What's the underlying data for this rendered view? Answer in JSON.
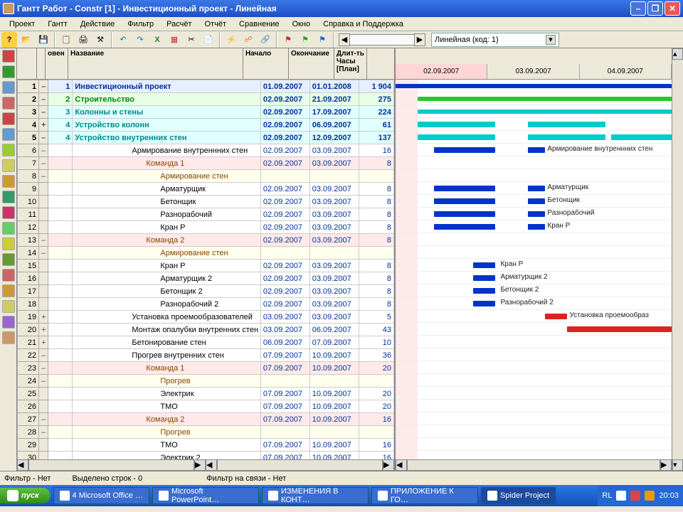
{
  "title": "Гантт Работ - Constr [1] - Инвестиционный проект - Линейная",
  "menu": [
    "Проект",
    "Гантт",
    "Действие",
    "Фильтр",
    "Расчёт",
    "Отчёт",
    "Сравнение",
    "Окно",
    "Справка и Поддержка"
  ],
  "combo": "Линейная (код: 1)",
  "headers": {
    "idx": "",
    "level": "овен",
    "name": "Название",
    "start": "Начало",
    "end": "Окончание",
    "dur": "Длит-ть Часы [План]"
  },
  "timeline": [
    "02.09.2007",
    "03.09.2007",
    "04.09.2007"
  ],
  "rows": [
    {
      "i": 1,
      "exp": "–",
      "lvl": "1",
      "name": "Инвестиционный проект",
      "start": "01.09.2007",
      "end": "01.01.2008",
      "dur": "1 904",
      "cls": "bold bgblue",
      "acc": "navy",
      "bars": [
        {
          "s": 0,
          "w": 100,
          "c": "#0033cc",
          "sum": true
        }
      ]
    },
    {
      "i": 2,
      "exp": "–",
      "lvl": "2",
      "name": "Строительство",
      "start": "02.09.2007",
      "end": "21.09.2007",
      "dur": "275",
      "cls": "bold bggreen",
      "acc": "green",
      "bars": [
        {
          "s": 8,
          "w": 100,
          "c": "#22cc22",
          "sum": true
        }
      ]
    },
    {
      "i": 3,
      "exp": "–",
      "lvl": "3",
      "name": "Колонны и стены",
      "start": "02.09.2007",
      "end": "17.09.2007",
      "dur": "224",
      "cls": "bold bgcyan",
      "acc": "teal",
      "bars": [
        {
          "s": 8,
          "w": 100,
          "c": "#00cccc",
          "sum": true
        }
      ]
    },
    {
      "i": 4,
      "exp": "+",
      "lvl": "4",
      "name": "Устройство колонн",
      "start": "02.09.2007",
      "end": "06.09.2007",
      "dur": "61",
      "cls": "bold bgcyan",
      "acc": "teal",
      "bars": [
        {
          "s": 8,
          "w": 28,
          "c": "#00cccc"
        },
        {
          "s": 48,
          "w": 28,
          "c": "#00cccc"
        }
      ]
    },
    {
      "i": 5,
      "exp": "–",
      "lvl": "4",
      "name": "Устройство внутренних стен",
      "start": "02.09.2007",
      "end": "12.09.2007",
      "dur": "137",
      "cls": "bold bgcyan",
      "acc": "teal",
      "bars": [
        {
          "s": 8,
          "w": 28,
          "c": "#00cccc"
        },
        {
          "s": 48,
          "w": 28,
          "c": "#00cccc"
        },
        {
          "s": 78,
          "w": 22,
          "c": "#00cccc"
        }
      ]
    },
    {
      "i": 6,
      "exp": "–",
      "lvl": "",
      "name": "Армирование внутреннних стен",
      "start": "02.09.2007",
      "end": "03.09.2007",
      "dur": "16",
      "pad": 80,
      "bars": [
        {
          "s": 14,
          "w": 22,
          "c": "#0033cc"
        },
        {
          "s": 48,
          "w": 6,
          "c": "#0033cc"
        }
      ],
      "glabel": "Армирование внутреннних стен",
      "glx": 55
    },
    {
      "i": 7,
      "exp": "–",
      "lvl": "",
      "name": "Команда 1",
      "start": "02.09.2007",
      "end": "03.09.2007",
      "dur": "8",
      "pad": 100,
      "cls": "bgpink",
      "acc": "brown"
    },
    {
      "i": 8,
      "exp": "–",
      "lvl": "",
      "name": "Армирование стен",
      "pad": 120,
      "cls": "bgyel",
      "acc": "brown"
    },
    {
      "i": 9,
      "exp": "",
      "lvl": "",
      "name": "Арматурщик",
      "start": "02.09.2007",
      "end": "03.09.2007",
      "dur": "8",
      "pad": 120,
      "bars": [
        {
          "s": 14,
          "w": 22,
          "c": "#0033cc"
        },
        {
          "s": 48,
          "w": 6,
          "c": "#0033cc"
        }
      ],
      "glabel": "Арматурщик",
      "glx": 55
    },
    {
      "i": 10,
      "exp": "",
      "lvl": "",
      "name": "Бетонщик",
      "start": "02.09.2007",
      "end": "03.09.2007",
      "dur": "8",
      "pad": 120,
      "bars": [
        {
          "s": 14,
          "w": 22,
          "c": "#0033cc"
        },
        {
          "s": 48,
          "w": 6,
          "c": "#0033cc"
        }
      ],
      "glabel": "Бетонщик",
      "glx": 55
    },
    {
      "i": 11,
      "exp": "",
      "lvl": "",
      "name": "Разнорабочий",
      "start": "02.09.2007",
      "end": "03.09.2007",
      "dur": "8",
      "pad": 120,
      "bars": [
        {
          "s": 14,
          "w": 22,
          "c": "#0033cc"
        },
        {
          "s": 48,
          "w": 6,
          "c": "#0033cc"
        }
      ],
      "glabel": "Разнорабочий",
      "glx": 55
    },
    {
      "i": 12,
      "exp": "",
      "lvl": "",
      "name": "Кран Р",
      "start": "02.09.2007",
      "end": "03.09.2007",
      "dur": "8",
      "pad": 120,
      "bars": [
        {
          "s": 14,
          "w": 22,
          "c": "#0033cc"
        },
        {
          "s": 48,
          "w": 6,
          "c": "#0033cc"
        }
      ],
      "glabel": "Кран Р",
      "glx": 55
    },
    {
      "i": 13,
      "exp": "–",
      "lvl": "",
      "name": "Команда 2",
      "start": "02.09.2007",
      "end": "03.09.2007",
      "dur": "8",
      "pad": 100,
      "cls": "bgpink",
      "acc": "brown"
    },
    {
      "i": 14,
      "exp": "–",
      "lvl": "",
      "name": "Армирование стен",
      "pad": 120,
      "cls": "bgyel",
      "acc": "brown"
    },
    {
      "i": 15,
      "exp": "",
      "lvl": "",
      "name": "Кран Р",
      "start": "02.09.2007",
      "end": "03.09.2007",
      "dur": "8",
      "pad": 120,
      "bars": [
        {
          "s": 28,
          "w": 8,
          "c": "#0033cc"
        }
      ],
      "glabel": "Кран Р",
      "glx": 38
    },
    {
      "i": 16,
      "exp": "",
      "lvl": "",
      "name": "Арматурщик 2",
      "start": "02.09.2007",
      "end": "03.09.2007",
      "dur": "8",
      "pad": 120,
      "bars": [
        {
          "s": 28,
          "w": 8,
          "c": "#0033cc"
        }
      ],
      "glabel": "Арматурщик 2",
      "glx": 38
    },
    {
      "i": 17,
      "exp": "",
      "lvl": "",
      "name": "Бетонщик 2",
      "start": "02.09.2007",
      "end": "03.09.2007",
      "dur": "8",
      "pad": 120,
      "bars": [
        {
          "s": 28,
          "w": 8,
          "c": "#0033cc"
        }
      ],
      "glabel": "Бетонщик 2",
      "glx": 38
    },
    {
      "i": 18,
      "exp": "",
      "lvl": "",
      "name": "Разнорабочий 2",
      "start": "02.09.2007",
      "end": "03.09.2007",
      "dur": "8",
      "pad": 120,
      "bars": [
        {
          "s": 28,
          "w": 8,
          "c": "#0033cc"
        }
      ],
      "glabel": "Разнорабочий 2",
      "glx": 38
    },
    {
      "i": 19,
      "exp": "+",
      "lvl": "",
      "name": " Установка проемообразователей",
      "start": "03.09.2007",
      "end": "03.09.2007",
      "dur": "5",
      "pad": 80,
      "bars": [
        {
          "s": 54,
          "w": 8,
          "c": "#dd2222"
        }
      ],
      "glabel": "Установка проемообраз",
      "glx": 63
    },
    {
      "i": 20,
      "exp": "+",
      "lvl": "",
      "name": "Монтаж опалубки внутренних стен",
      "start": "03.09.2007",
      "end": "06.09.2007",
      "dur": "43",
      "pad": 80,
      "bars": [
        {
          "s": 62,
          "w": 38,
          "c": "#dd2222"
        }
      ]
    },
    {
      "i": 21,
      "exp": "+",
      "lvl": "",
      "name": "Бетонирование стен",
      "start": "06.09.2007",
      "end": "07.09.2007",
      "dur": "10",
      "pad": 80
    },
    {
      "i": 22,
      "exp": "–",
      "lvl": "",
      "name": "Прогрев внутренних стен",
      "start": "07.09.2007",
      "end": "10.09.2007",
      "dur": "36",
      "pad": 80
    },
    {
      "i": 23,
      "exp": "–",
      "lvl": "",
      "name": "Команда 1",
      "start": "07.09.2007",
      "end": "10.09.2007",
      "dur": "20",
      "pad": 100,
      "cls": "bgpink",
      "acc": "brown"
    },
    {
      "i": 24,
      "exp": "–",
      "lvl": "",
      "name": "Прогрев",
      "pad": 120,
      "cls": "bgyel",
      "acc": "brown"
    },
    {
      "i": 25,
      "exp": "",
      "lvl": "",
      "name": "Электрик",
      "start": "07.09.2007",
      "end": "10.09.2007",
      "dur": "20",
      "pad": 120
    },
    {
      "i": 26,
      "exp": "",
      "lvl": "",
      "name": "ТМО",
      "start": "07.09.2007",
      "end": "10.09.2007",
      "dur": "20",
      "pad": 120
    },
    {
      "i": 27,
      "exp": "–",
      "lvl": "",
      "name": "Команда 2",
      "start": "07.09.2007",
      "end": "10.09.2007",
      "dur": "16",
      "pad": 100,
      "cls": "bgpink",
      "acc": "brown"
    },
    {
      "i": 28,
      "exp": "–",
      "lvl": "",
      "name": "Прогрев",
      "pad": 120,
      "cls": "bgyel",
      "acc": "brown"
    },
    {
      "i": 29,
      "exp": "",
      "lvl": "",
      "name": "ТМО",
      "start": "07.09.2007",
      "end": "10.09.2007",
      "dur": "16",
      "pad": 120
    },
    {
      "i": 30,
      "exp": "",
      "lvl": "",
      "name": "Электрик 2",
      "start": "07.09.2007",
      "end": "10.09.2007",
      "dur": "16",
      "pad": 120
    }
  ],
  "status": {
    "filter": "Фильтр -  Нет",
    "selected": "Выделено строк -  0",
    "linkfilter": "Фильтр на связи -  Нет"
  },
  "taskbar": {
    "start": "пуск",
    "tasks": [
      "4 Microsoft Office …",
      "Microsoft PowerPoint…",
      "ИЗМЕНЕНИЯ В КОНТ…",
      "ПРИЛОЖЕНИЕ К ГО…",
      "Spider Project"
    ],
    "active": 4,
    "lang": "RL",
    "time": "20:03"
  },
  "sidebar_colors": [
    "#c44",
    "#393",
    "#69c",
    "#c66",
    "#c44",
    "#69c",
    "#9c3",
    "#cc6",
    "#c93",
    "#396",
    "#c36",
    "#6c6",
    "#cc3",
    "#693",
    "#c66",
    "#c93",
    "#cc6",
    "#96c",
    "#c96"
  ]
}
